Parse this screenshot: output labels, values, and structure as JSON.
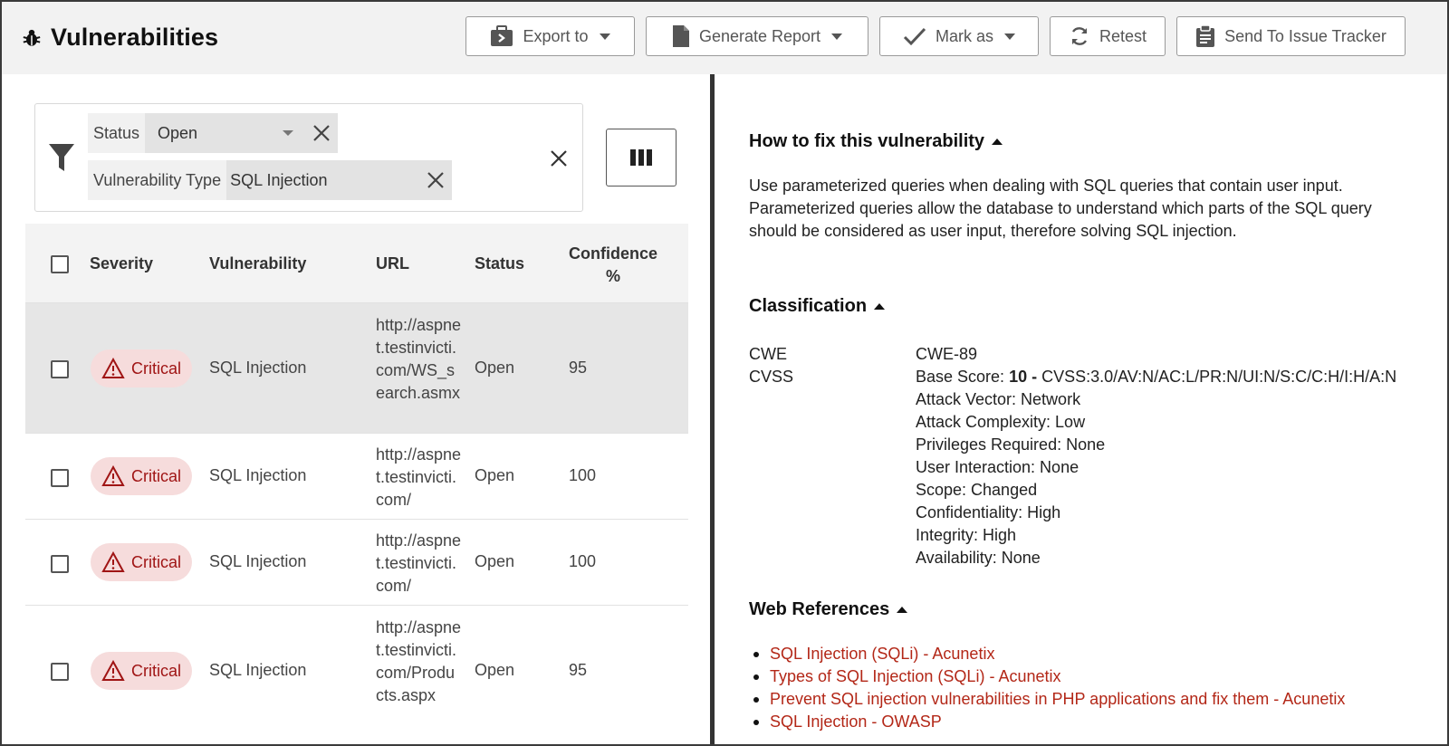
{
  "header": {
    "title": "Vulnerabilities",
    "buttons": {
      "export": "Export to",
      "generate": "Generate Report",
      "mark": "Mark as",
      "retest": "Retest",
      "send": "Send To Issue Tracker"
    }
  },
  "filters": {
    "status_label": "Status",
    "status_value": "Open",
    "type_label": "Vulnerability Type",
    "type_value": "SQL Injection"
  },
  "table": {
    "headers": {
      "severity": "Severity",
      "vulnerability": "Vulnerability",
      "url": "URL",
      "status": "Status",
      "confidence": "Confidence %"
    },
    "rows": [
      {
        "severity": "Critical",
        "vulnerability": "SQL Injection",
        "url": "http://aspnet.testinvicti.com/WS_search.asmx",
        "status": "Open",
        "confidence": "95"
      },
      {
        "severity": "Critical",
        "vulnerability": "SQL Injection",
        "url": "http://aspnet.testinvicti.com/",
        "status": "Open",
        "confidence": "100"
      },
      {
        "severity": "Critical",
        "vulnerability": "SQL Injection",
        "url": "http://aspnet.testinvicti.com/",
        "status": "Open",
        "confidence": "100"
      },
      {
        "severity": "Critical",
        "vulnerability": "SQL Injection",
        "url": "http://aspnet.testinvicti.com/Products.aspx",
        "status": "Open",
        "confidence": "95"
      }
    ]
  },
  "detail": {
    "fix_heading": "How to fix this vulnerability",
    "fix_text": "Use parameterized queries when dealing with SQL queries that contain user input. Parameterized queries allow the database to understand which parts of the SQL query should be considered as user input, therefore solving SQL injection.",
    "classification_heading": "Classification",
    "cwe_label": "CWE",
    "cwe_value": "CWE-89",
    "cvss_label": "CVSS",
    "cvss_base_prefix": "Base Score: ",
    "cvss_base_score": "10 -",
    "cvss_vector": " CVSS:3.0/AV:N/AC:L/PR:N/UI:N/S:C/C:H/I:H/A:N",
    "cvss_details": [
      "Attack Vector: Network",
      "Attack Complexity: Low",
      "Privileges Required: None",
      "User Interaction: None",
      "Scope: Changed",
      "Confidentiality: High",
      "Integrity: High",
      "Availability: None"
    ],
    "refs_heading": "Web References",
    "refs": [
      "SQL Injection (SQLi) - Acunetix",
      "Types of SQL Injection (SQLi) - Acunetix",
      "Prevent SQL injection vulnerabilities in PHP applications and fix them - Acunetix",
      "SQL Injection - OWASP"
    ]
  },
  "colors": {
    "critical_text": "#a01515",
    "critical_bg": "#f6dcdc",
    "link": "#b32717"
  },
  "icons": {
    "title": "bug-icon",
    "export": "export-icon",
    "generate": "document-icon",
    "mark": "check-icon",
    "retest": "refresh-icon",
    "send": "clipboard-icon",
    "filter": "filter-icon",
    "columns": "columns-icon",
    "severity": "warning-icon"
  }
}
